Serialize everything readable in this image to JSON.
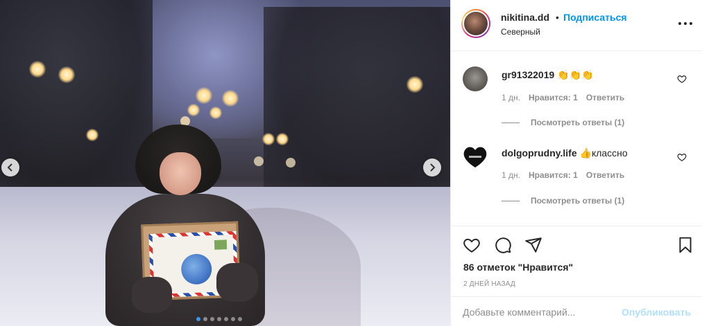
{
  "post": {
    "username": "nikitina.dd",
    "bullet": "•",
    "follow_label": "Подписаться",
    "location": "Северный"
  },
  "comments": [
    {
      "username": "gr91322019",
      "text": "👏👏👏",
      "age": "1 дн.",
      "likes": "Нравится: 1",
      "reply": "Ответить",
      "replies": "Посмотреть ответы (1)"
    },
    {
      "username": "dolgoprudny.life",
      "text": "👍классно",
      "age": "1 дн.",
      "likes": "Нравится: 1",
      "reply": "Ответить",
      "replies": "Посмотреть ответы (1)"
    }
  ],
  "stats": {
    "likes": "86 отметок \"Нравится\"",
    "date": "2 ДНЕЙ НАЗАД"
  },
  "comment_box": {
    "placeholder": "Добавьте комментарий...",
    "publish": "Опубликовать"
  },
  "carousel": {
    "slides": 7,
    "active": 1
  },
  "icons": {
    "prev": "chevron-left-icon",
    "next": "chevron-right-icon",
    "more": "more-options-icon",
    "like": "heart-icon",
    "comment": "comment-icon",
    "share": "send-icon",
    "save": "bookmark-icon"
  },
  "colors": {
    "accent": "#0095f6",
    "publish_disabled": "#b2dffc",
    "muted": "#8e8e8e",
    "text": "#262626"
  }
}
